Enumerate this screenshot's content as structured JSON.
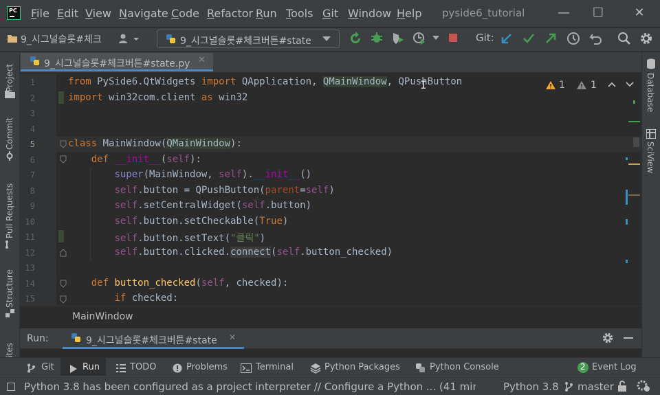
{
  "window": {
    "title": "pyside6_tutorial",
    "min": "—",
    "max": "☐",
    "close": "✕"
  },
  "menu": [
    {
      "label": "File",
      "key": "F",
      "rest": "ile"
    },
    {
      "label": "Edit",
      "key": "E",
      "rest": "dit"
    },
    {
      "label": "View",
      "key": "V",
      "rest": "iew"
    },
    {
      "label": "Navigate",
      "key": "N",
      "rest": "avigate"
    },
    {
      "label": "Code",
      "key": "C",
      "rest": "ode"
    },
    {
      "label": "Refactor",
      "key": "R",
      "rest": "efactor"
    },
    {
      "label": "Run",
      "key": "R",
      "rest": "un"
    },
    {
      "label": "Tools",
      "key": "T",
      "rest": "ools"
    },
    {
      "label": "Git",
      "key": "G",
      "rest": "it"
    },
    {
      "label": "Window",
      "key": "W",
      "rest": "indow"
    },
    {
      "label": "Help",
      "key": "H",
      "rest": "elp"
    }
  ],
  "toolbar": {
    "project_crumb": "9_시그널슬롯#체크",
    "run_config": "9_시그널슬롯#체크버튼#state",
    "git_label": "Git:"
  },
  "editor": {
    "tab_label": "9_시그널슬롯#체크버튼#state.py",
    "inspections": {
      "warnings": "1",
      "weak_warnings": "1"
    },
    "breadcrumb": "MainWindow"
  },
  "left_tools": [
    "Project",
    "Commit",
    "Pull Requests",
    "Structure",
    "orites"
  ],
  "right_tools": [
    "Database",
    "SciView"
  ],
  "run": {
    "label": "Run:",
    "tab": "9_시그널슬롯#체크버튼#state"
  },
  "bottom_tools": [
    {
      "label": "Git"
    },
    {
      "label": "Run"
    },
    {
      "label": "TODO"
    },
    {
      "label": "Problems"
    },
    {
      "label": "Terminal"
    },
    {
      "label": "Python Packages"
    },
    {
      "label": "Python Console"
    }
  ],
  "event_log": {
    "count": "2",
    "label": "Event Log"
  },
  "status": {
    "message": "Python 3.8 has been configured as a project interpreter // Configure a Python ... (41 minutes ago)",
    "interpreter": "Python 3.8",
    "branch": "master"
  },
  "colors": {
    "keyword": "#cc7832",
    "string": "#6a8759",
    "self": "#94558d",
    "function": "#ffc66d",
    "accent": "#4a88c7",
    "event_badge": "#499c54"
  }
}
